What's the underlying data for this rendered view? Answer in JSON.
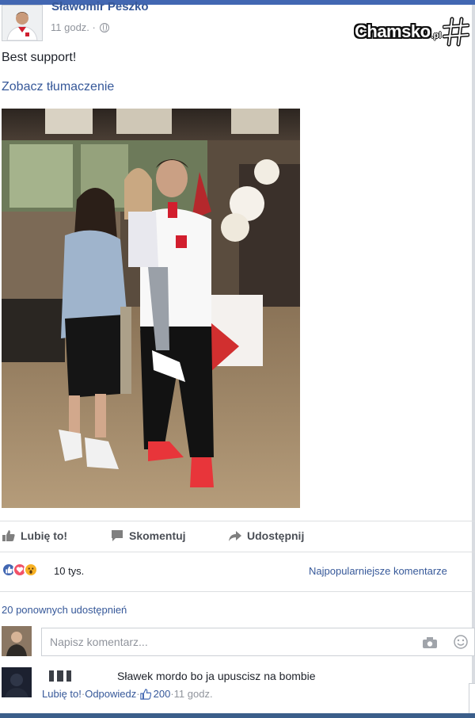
{
  "post": {
    "author": "Sławomir Peszko",
    "time": "11 godz. ·",
    "text": "Best support!",
    "see_translation": "Zobacz tłumaczenie"
  },
  "watermark": {
    "brand": "Chamsko",
    "suffix": ".pl"
  },
  "actions": {
    "like": "Lubię to!",
    "comment": "Skomentuj",
    "share": "Udostępnij"
  },
  "reactions": {
    "count": "10 tys.",
    "top_comments": "Najpopularniejsze komentarze",
    "colors": {
      "like": "#4267b2",
      "love": "#f25268",
      "wow": "#f7b125"
    }
  },
  "shares": "20 ponownych udostępnień",
  "comment_box": {
    "placeholder": "Napisz komentarz..."
  },
  "comment": {
    "text": "Sławek mordo bo ja upuscisz na bombie",
    "like": "Lubię to!",
    "sep1": " · ",
    "reply": "Odpowiedz",
    "sep2": " · ",
    "likes": "200",
    "sep3": " · ",
    "time": "11 godz."
  }
}
